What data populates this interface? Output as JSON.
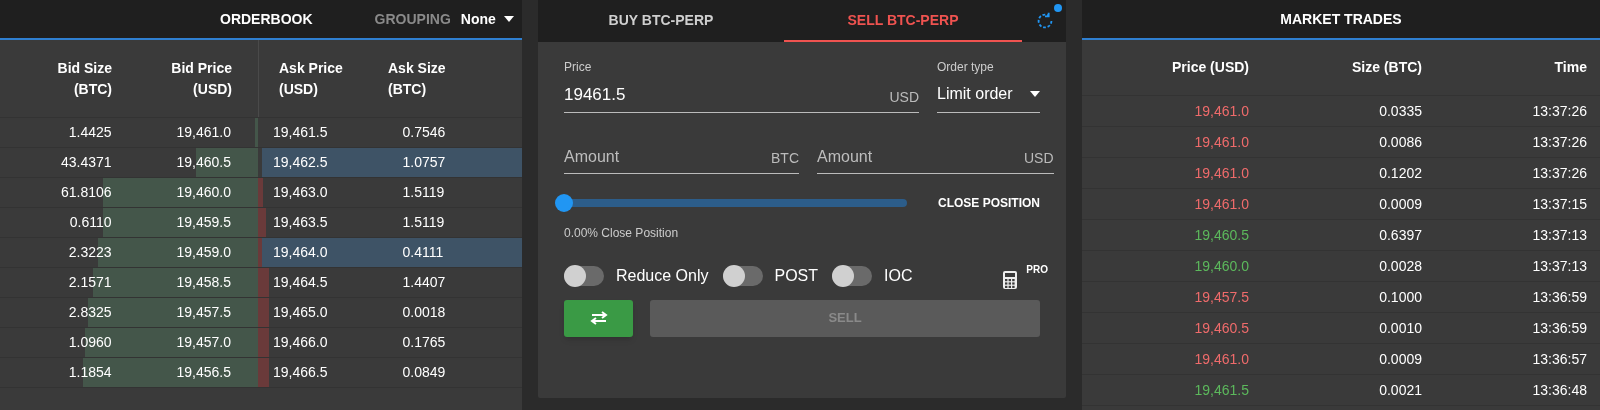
{
  "orderbook": {
    "title": "ORDERBOOK",
    "grouping_label": "GROUPING",
    "grouping_value": "None",
    "columns": [
      "Bid Size\n(BTC)",
      "Bid Price\n(USD)",
      "Ask Price\n(USD)",
      "Ask Size\n(BTC)"
    ],
    "rows": [
      {
        "bid_size": "1.4425",
        "bid_price": "19,461.0",
        "ask_price": "19,461.5",
        "ask_size": "0.7546",
        "selected": false
      },
      {
        "bid_size": "43.4371",
        "bid_price": "19,460.5",
        "ask_price": "19,462.5",
        "ask_size": "1.0757",
        "selected": true
      },
      {
        "bid_size": "61.8106",
        "bid_price": "19,460.0",
        "ask_price": "19,463.0",
        "ask_size": "1.5119",
        "selected": false
      },
      {
        "bid_size": "0.6110",
        "bid_price": "19,459.5",
        "ask_price": "19,463.5",
        "ask_size": "1.5119",
        "selected": false
      },
      {
        "bid_size": "2.3223",
        "bid_price": "19,459.0",
        "ask_price": "19,464.0",
        "ask_size": "0.4111",
        "selected": true
      },
      {
        "bid_size": "2.1571",
        "bid_price": "19,458.5",
        "ask_price": "19,464.5",
        "ask_size": "1.4407",
        "selected": false
      },
      {
        "bid_size": "2.8325",
        "bid_price": "19,457.5",
        "ask_price": "19,465.0",
        "ask_size": "0.0018",
        "selected": false
      },
      {
        "bid_size": "1.0960",
        "bid_price": "19,457.0",
        "ask_price": "19,466.0",
        "ask_size": "0.1765",
        "selected": false
      },
      {
        "bid_size": "1.1854",
        "bid_price": "19,456.5",
        "ask_price": "19,466.5",
        "ask_size": "0.0849",
        "selected": false
      }
    ]
  },
  "order_form": {
    "tabs": [
      {
        "label": "BUY BTC-PERP",
        "selected": false,
        "kind": "buy"
      },
      {
        "label": "SELL BTC-PERP",
        "selected": true,
        "kind": "sell"
      }
    ],
    "price": {
      "label": "Price",
      "value": "19461.5",
      "unit": "USD"
    },
    "order_type": {
      "label": "Order type",
      "value": "Limit order"
    },
    "amount_btc": {
      "placeholder": "Amount",
      "unit": "BTC"
    },
    "amount_usd": {
      "placeholder": "Amount",
      "unit": "USD"
    },
    "slider": {
      "level": 0,
      "caption": "0.00% Close Position"
    },
    "close_position": "CLOSE POSITION",
    "toggles": [
      {
        "label": "Reduce Only",
        "on": false
      },
      {
        "label": "POST",
        "on": false
      },
      {
        "label": "IOC",
        "on": false
      }
    ],
    "pro_badge": "PRO",
    "submit": {
      "label": "SELL",
      "disabled": true
    }
  },
  "market_trades": {
    "title": "MARKET TRADES",
    "columns": [
      "Price (USD)",
      "Size (BTC)",
      "Time"
    ],
    "rows": [
      {
        "price": "19,461.0",
        "size": "0.0335",
        "time": "13:37:26",
        "kind": "sell"
      },
      {
        "price": "19,461.0",
        "size": "0.0086",
        "time": "13:37:26",
        "kind": "sell"
      },
      {
        "price": "19,461.0",
        "size": "0.1202",
        "time": "13:37:26",
        "kind": "sell"
      },
      {
        "price": "19,461.0",
        "size": "0.0009",
        "time": "13:37:15",
        "kind": "sell"
      },
      {
        "price": "19,460.5",
        "size": "0.6397",
        "time": "13:37:13",
        "kind": "buy"
      },
      {
        "price": "19,460.0",
        "size": "0.0028",
        "time": "13:37:13",
        "kind": "buy"
      },
      {
        "price": "19,457.5",
        "size": "0.1000",
        "time": "13:36:59",
        "kind": "sell"
      },
      {
        "price": "19,460.5",
        "size": "0.0010",
        "time": "13:36:59",
        "kind": "sell"
      },
      {
        "price": "19,461.0",
        "size": "0.0009",
        "time": "13:36:57",
        "kind": "sell"
      },
      {
        "price": "19,461.5",
        "size": "0.0021",
        "time": "13:36:48",
        "kind": "buy"
      }
    ]
  }
}
